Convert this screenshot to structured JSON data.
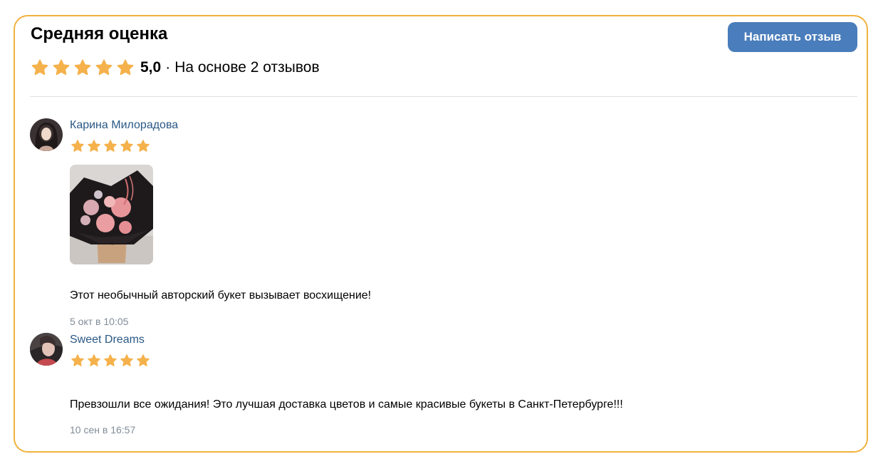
{
  "header": {
    "title": "Средняя оценка",
    "rating": "5,0",
    "separator": "·",
    "based_on": "На основе 2 отзывов",
    "stars": 5,
    "write_button": "Написать отзыв"
  },
  "reviews": [
    {
      "author": "Карина Милорадова",
      "stars": 5,
      "text": "Этот необычный авторский букет вызывает восхищение!",
      "date": "5 окт в 10:05"
    },
    {
      "author": "Sweet Dreams",
      "stars": 5,
      "text": "Превзошли все ожидания! Это лучшая доставка цветов и самые красивые букеты в Санкт-Петербурге!!!",
      "date": "10 сен в 16:57"
    }
  ],
  "colors": {
    "star": "#f5b14b",
    "border": "#f0b23e",
    "button": "#4a7dbb",
    "author": "#2a5885",
    "date": "#818c99"
  }
}
